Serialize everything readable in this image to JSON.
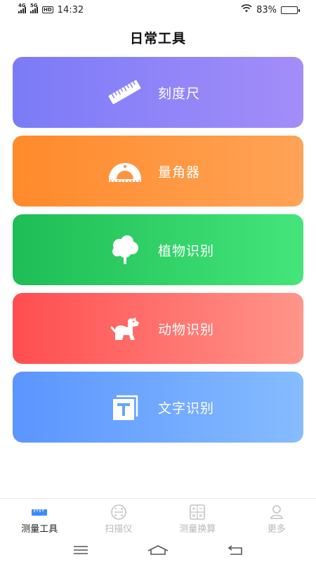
{
  "status": {
    "signal1": "4G",
    "signal2": "5G",
    "hd": "HD",
    "time": "14:32",
    "battery": "83%",
    "battery_level": 0.83
  },
  "page": {
    "title": "日常工具"
  },
  "tools": [
    {
      "label": "刻度尺",
      "icon": "ruler-icon",
      "color_from": "#7b7bf7",
      "color_to": "#a38df9"
    },
    {
      "label": "量角器",
      "icon": "protractor-icon",
      "color_from": "#ff8a2b",
      "color_to": "#ffa356"
    },
    {
      "label": "植物识别",
      "icon": "tree-icon",
      "color_from": "#1ebd55",
      "color_to": "#44e57a"
    },
    {
      "label": "动物识别",
      "icon": "dog-icon",
      "color_from": "#ff4d4f",
      "color_to": "#ff958a"
    },
    {
      "label": "文字识别",
      "icon": "text-recognition-icon",
      "color_from": "#5b95ff",
      "color_to": "#86bcff"
    }
  ],
  "bottom_nav": [
    {
      "label": "测量工具",
      "icon": "ruler-tab-icon",
      "active": true
    },
    {
      "label": "扫描仪",
      "icon": "scanner-icon",
      "active": false
    },
    {
      "label": "测量换算",
      "icon": "calculator-icon",
      "active": false
    },
    {
      "label": "更多",
      "icon": "person-icon",
      "active": false
    }
  ],
  "system_nav": [
    "menu-icon",
    "home-icon",
    "back-icon"
  ],
  "colors": {
    "active_tab": "#3a8cff",
    "inactive": "#b8b8b8",
    "text": "#222222"
  }
}
